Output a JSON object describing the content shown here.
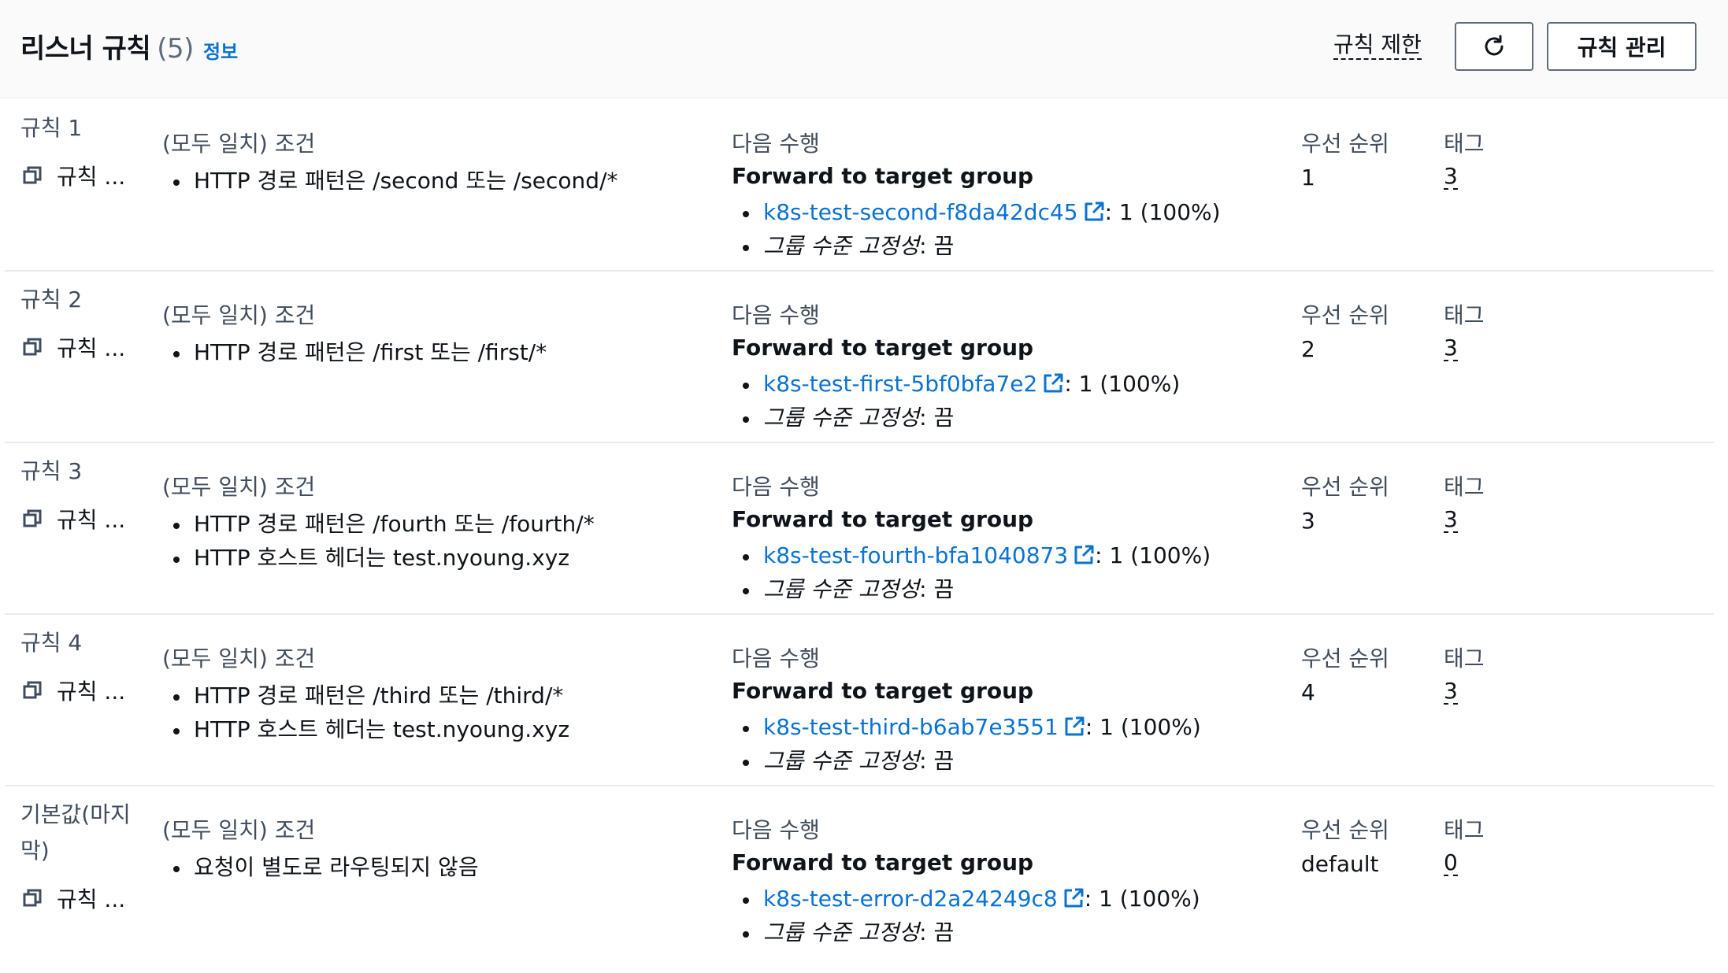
{
  "header": {
    "title": "리스너 규칙",
    "count": "(5)",
    "info_link": "정보",
    "limit_link": "규칙 제한",
    "refresh_icon": "refresh-icon",
    "manage_button": "규칙 관리"
  },
  "columns": {
    "conditions": "(모두 일치) 조건",
    "action": "다음 수행",
    "priority": "우선 순위",
    "tags": "태그"
  },
  "colors": {
    "link": "#0972d3",
    "text": "#0f141a",
    "label": "#414d5c",
    "divider": "#e9ebed"
  },
  "rules": [
    {
      "name": "규칙 1",
      "copy_label": "규칙 ...",
      "conditions": [
        "HTTP 경로 패턴은 /second 또는 /second/*"
      ],
      "action_title": "Forward to target group",
      "target_group": "k8s-test-second-f8da42dc45",
      "weight": ": 1 (100%)",
      "stickiness_label": "그룹 수준 고정성",
      "stickiness_value": ": 끔",
      "priority": "1",
      "tags": "3"
    },
    {
      "name": "규칙 2",
      "copy_label": "규칙 ...",
      "conditions": [
        "HTTP 경로 패턴은 /first 또는 /first/*"
      ],
      "action_title": "Forward to target group",
      "target_group": "k8s-test-first-5bf0bfa7e2",
      "weight": ": 1 (100%)",
      "stickiness_label": "그룹 수준 고정성",
      "stickiness_value": ": 끔",
      "priority": "2",
      "tags": "3"
    },
    {
      "name": "규칙 3",
      "copy_label": "규칙 ...",
      "conditions": [
        "HTTP 경로 패턴은 /fourth 또는 /fourth/*",
        "HTTP 호스트 헤더는 test.nyoung.xyz"
      ],
      "action_title": "Forward to target group",
      "target_group": "k8s-test-fourth-bfa1040873",
      "weight": ": 1 (100%)",
      "stickiness_label": "그룹 수준 고정성",
      "stickiness_value": ": 끔",
      "priority": "3",
      "tags": "3"
    },
    {
      "name": "규칙 4",
      "copy_label": "규칙 ...",
      "conditions": [
        "HTTP 경로 패턴은 /third 또는 /third/*",
        "HTTP 호스트 헤더는 test.nyoung.xyz"
      ],
      "action_title": "Forward to target group",
      "target_group": "k8s-test-third-b6ab7e3551",
      "weight": ": 1 (100%)",
      "stickiness_label": "그룹 수준 고정성",
      "stickiness_value": ": 끔",
      "priority": "4",
      "tags": "3"
    },
    {
      "name": "기본값(마지막)",
      "copy_label": "규칙 ...",
      "conditions": [
        "요청이 별도로 라우팅되지 않음"
      ],
      "action_title": "Forward to target group",
      "target_group": "k8s-test-error-d2a24249c8",
      "weight": ": 1 (100%)",
      "stickiness_label": "그룹 수준 고정성",
      "stickiness_value": ": 끔",
      "priority": "default",
      "tags": "0"
    }
  ]
}
